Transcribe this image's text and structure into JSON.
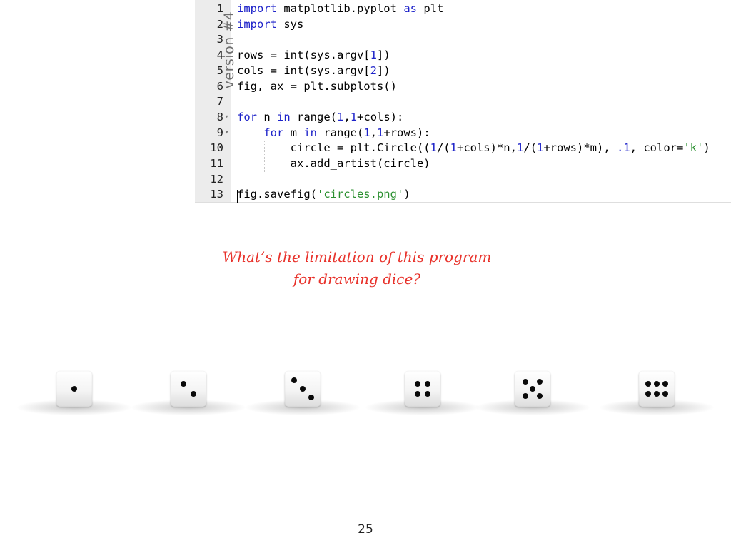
{
  "editor": {
    "side_label": "version #4",
    "lines": [
      {
        "no": "1",
        "fold": "",
        "tokens": [
          {
            "t": "import",
            "c": "kw"
          },
          {
            "t": " matplotlib.pyplot ",
            "c": ""
          },
          {
            "t": "as",
            "c": "kw"
          },
          {
            "t": " plt",
            "c": ""
          }
        ]
      },
      {
        "no": "2",
        "fold": "",
        "tokens": [
          {
            "t": "import",
            "c": "kw"
          },
          {
            "t": " sys",
            "c": ""
          }
        ]
      },
      {
        "no": "3",
        "fold": "",
        "tokens": []
      },
      {
        "no": "4",
        "fold": "",
        "tokens": [
          {
            "t": "rows = int(sys.argv[",
            "c": ""
          },
          {
            "t": "1",
            "c": "num"
          },
          {
            "t": "])",
            "c": ""
          }
        ]
      },
      {
        "no": "5",
        "fold": "",
        "tokens": [
          {
            "t": "cols = int(sys.argv[",
            "c": ""
          },
          {
            "t": "2",
            "c": "num"
          },
          {
            "t": "])",
            "c": ""
          }
        ]
      },
      {
        "no": "6",
        "fold": "",
        "tokens": [
          {
            "t": "fig, ax = plt.subplots()",
            "c": ""
          }
        ]
      },
      {
        "no": "7",
        "fold": "",
        "tokens": []
      },
      {
        "no": "8",
        "fold": "▾",
        "tokens": [
          {
            "t": "for",
            "c": "kw"
          },
          {
            "t": " n ",
            "c": ""
          },
          {
            "t": "in",
            "c": "kw"
          },
          {
            "t": " range(",
            "c": ""
          },
          {
            "t": "1",
            "c": "num"
          },
          {
            "t": ",",
            "c": ""
          },
          {
            "t": "1",
            "c": "num"
          },
          {
            "t": "+cols):",
            "c": ""
          }
        ]
      },
      {
        "no": "9",
        "fold": "▾",
        "tokens": [
          {
            "t": "    ",
            "c": ""
          },
          {
            "t": "for",
            "c": "kw"
          },
          {
            "t": " m ",
            "c": ""
          },
          {
            "t": "in",
            "c": "kw"
          },
          {
            "t": " range(",
            "c": ""
          },
          {
            "t": "1",
            "c": "num"
          },
          {
            "t": ",",
            "c": ""
          },
          {
            "t": "1",
            "c": "num"
          },
          {
            "t": "+rows):",
            "c": ""
          }
        ]
      },
      {
        "no": "10",
        "fold": "",
        "tokens": [
          {
            "t": "        circle = plt.Circle((",
            "c": ""
          },
          {
            "t": "1",
            "c": "num"
          },
          {
            "t": "/(",
            "c": ""
          },
          {
            "t": "1",
            "c": "num"
          },
          {
            "t": "+cols)*n,",
            "c": ""
          },
          {
            "t": "1",
            "c": "num"
          },
          {
            "t": "/(",
            "c": ""
          },
          {
            "t": "1",
            "c": "num"
          },
          {
            "t": "+rows)*m), ",
            "c": ""
          },
          {
            "t": ".1",
            "c": "num"
          },
          {
            "t": ", color=",
            "c": ""
          },
          {
            "t": "'k'",
            "c": "str"
          },
          {
            "t": ")",
            "c": ""
          }
        ]
      },
      {
        "no": "11",
        "fold": "",
        "tokens": [
          {
            "t": "        ax.add_artist(circle)",
            "c": ""
          }
        ]
      },
      {
        "no": "12",
        "fold": "",
        "tokens": []
      },
      {
        "no": "13",
        "fold": "",
        "tokens": [
          {
            "t": "fig.savefig(",
            "c": ""
          },
          {
            "t": "'circles.png'",
            "c": "str"
          },
          {
            "t": ")",
            "c": ""
          }
        ]
      }
    ]
  },
  "question": {
    "line1": "What’s the limitation of this program",
    "line2": "for drawing dice?"
  },
  "dice": [
    {
      "face": 1
    },
    {
      "face": 2
    },
    {
      "face": 3
    },
    {
      "face": 4
    },
    {
      "face": 5
    },
    {
      "face": 6
    }
  ],
  "page_number": "25"
}
